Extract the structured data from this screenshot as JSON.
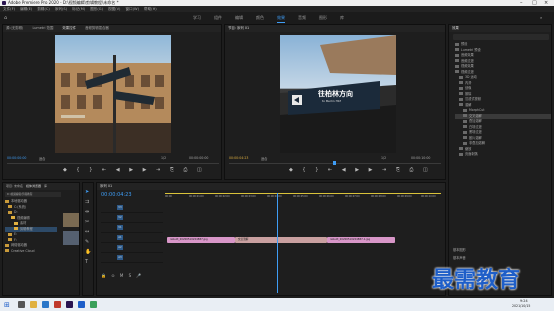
{
  "window": {
    "title": "Adobe Premiere Pro 2020 - D:\\视频编辑\\剪辑教程\\未命名 *"
  },
  "menu": [
    "文件(F)",
    "编辑(E)",
    "剪辑(C)",
    "序列(S)",
    "标记(M)",
    "图形(G)",
    "视图(V)",
    "窗口(W)",
    "帮助(H)"
  ],
  "workspaces": [
    "学习",
    "组件",
    "编辑",
    "颜色",
    "效果",
    "音频",
    "图形",
    "库"
  ],
  "active_workspace_index": 4,
  "source_panel": {
    "tabs": [
      "源:(无剪辑)",
      "Lumetri 范围",
      "效果控件",
      "音频剪辑混合器"
    ],
    "timecode": "00:00:00:00",
    "fit": "适合",
    "ratio": "1/2",
    "end_timecode": "00:00:00:00"
  },
  "program_panel": {
    "tabs": [
      "节目: 序列 01"
    ],
    "timecode": "00:00:04:23",
    "fit": "适合",
    "ratio": "1/2",
    "end_timecode": "00:00:10:00",
    "sign_text": "往柏林方向",
    "sign_sub": "to Berlin Hbf"
  },
  "project_panel": {
    "tabs": [
      "项目: 未命名",
      "媒体浏览器",
      "库",
      "信息"
    ],
    "path": "D:\\视频编辑\\剪辑教程",
    "items": [
      "本地驱动器",
      "C:(系统)",
      "D:",
      "视频编辑",
      "素材",
      "剪辑教程",
      "E:",
      "F:",
      "网络驱动器",
      "Creative Cloud"
    ]
  },
  "timeline": {
    "tab": "序列 01",
    "timecode": "00:00:04:23",
    "ruler": [
      "00:00",
      "00:00:01:00",
      "00:00:02:00",
      "00:00:03:00",
      "00:00:04:00",
      "00:00:05:00",
      "00:00:06:00",
      "00:00:07:00",
      "00:00:08:00",
      "00:00:09:00",
      "00:00:10:00"
    ],
    "tracks": [
      "V3",
      "V2",
      "V1",
      "A1",
      "A2",
      "A3"
    ],
    "clips": [
      {
        "label": "rebuilt_20200510224887.jpg",
        "color": "#d896c8"
      },
      {
        "label": "交叉溶解",
        "color": "#c9a0a0"
      },
      {
        "label": "rebuilt_20200510224887-1.jpg",
        "color": "#d896c8"
      }
    ]
  },
  "effects_panel": {
    "tab": "效果",
    "items": [
      "预设",
      "Lumetri 预设",
      "音频效果",
      "音频过渡",
      "视频效果",
      "视频过渡",
      "3D 运动",
      "内滑",
      "划像",
      "擦除",
      "沉浸式视频",
      "溶解",
      "MorphCut",
      "交叉溶解",
      "叠加溶解",
      "白场过渡",
      "黑场过渡",
      "胶片溶解",
      "非叠加溶解",
      "缩放",
      "页面剥落"
    ],
    "bottom": [
      "基本图形",
      "基本声音"
    ]
  },
  "watermark": "最需教育",
  "taskbar": {
    "time": "9:24",
    "date": "2021/10/15"
  },
  "colors": {
    "accent": "#3f9df5",
    "clip_pink": "#d896c8",
    "timeline_ruler_yellow": "#d9c23a"
  }
}
